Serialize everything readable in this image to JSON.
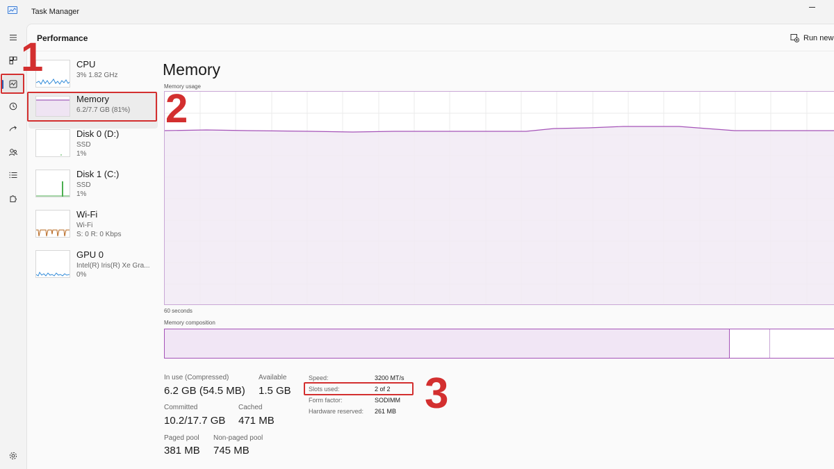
{
  "window": {
    "title": "Task Manager"
  },
  "header": {
    "title": "Performance",
    "run_task_label": "Run new t"
  },
  "resources": [
    {
      "name": "CPU",
      "sub1": "3%  1.82 GHz",
      "sub2": "",
      "sub3": "",
      "color": "#2f8ad8"
    },
    {
      "name": "Memory",
      "sub1": "6.2/7.7 GB (81%)",
      "sub2": "",
      "sub3": "",
      "color": "#8e3aa8"
    },
    {
      "name": "Disk 0 (D:)",
      "sub1": "SSD",
      "sub2": "1%",
      "sub3": "",
      "color": "#4caf50"
    },
    {
      "name": "Disk 1 (C:)",
      "sub1": "SSD",
      "sub2": "1%",
      "sub3": "",
      "color": "#4caf50"
    },
    {
      "name": "Wi-Fi",
      "sub1": "Wi-Fi",
      "sub2": "S: 0  R: 0 Kbps",
      "sub3": "",
      "color": "#b5651d"
    },
    {
      "name": "GPU 0",
      "sub1": "Intel(R) Iris(R) Xe Gra...",
      "sub2": "0%",
      "sub3": "",
      "color": "#2f8ad8"
    }
  ],
  "detail": {
    "title": "Memory",
    "usage_label": "Memory usage",
    "time_label": "60 seconds",
    "composition_label": "Memory composition",
    "stats": {
      "in_use_label": "In use (Compressed)",
      "in_use_value": "6.2 GB (54.5 MB)",
      "available_label": "Available",
      "available_value": "1.5 GB",
      "committed_label": "Committed",
      "committed_value": "10.2/17.7 GB",
      "cached_label": "Cached",
      "cached_value": "471 MB",
      "paged_label": "Paged pool",
      "paged_value": "381 MB",
      "nonpaged_label": "Non-paged pool",
      "nonpaged_value": "745 MB"
    },
    "specs": {
      "speed_label": "Speed:",
      "speed_value": "3200 MT/s",
      "slots_label": "Slots used:",
      "slots_value": "2 of 2",
      "form_label": "Form factor:",
      "form_value": "SODIMM",
      "hw_label": "Hardware reserved:",
      "hw_value": "261 MB"
    },
    "usage_percent": 81,
    "composition": {
      "in_use_fraction": 0.84,
      "modified_fraction": 0.06
    }
  },
  "annotations": {
    "one": "1",
    "two": "2",
    "three": "3"
  },
  "colors": {
    "accent": "#2b5fb4",
    "memory": "#8e3aa8",
    "annotation": "#d32f2f"
  }
}
